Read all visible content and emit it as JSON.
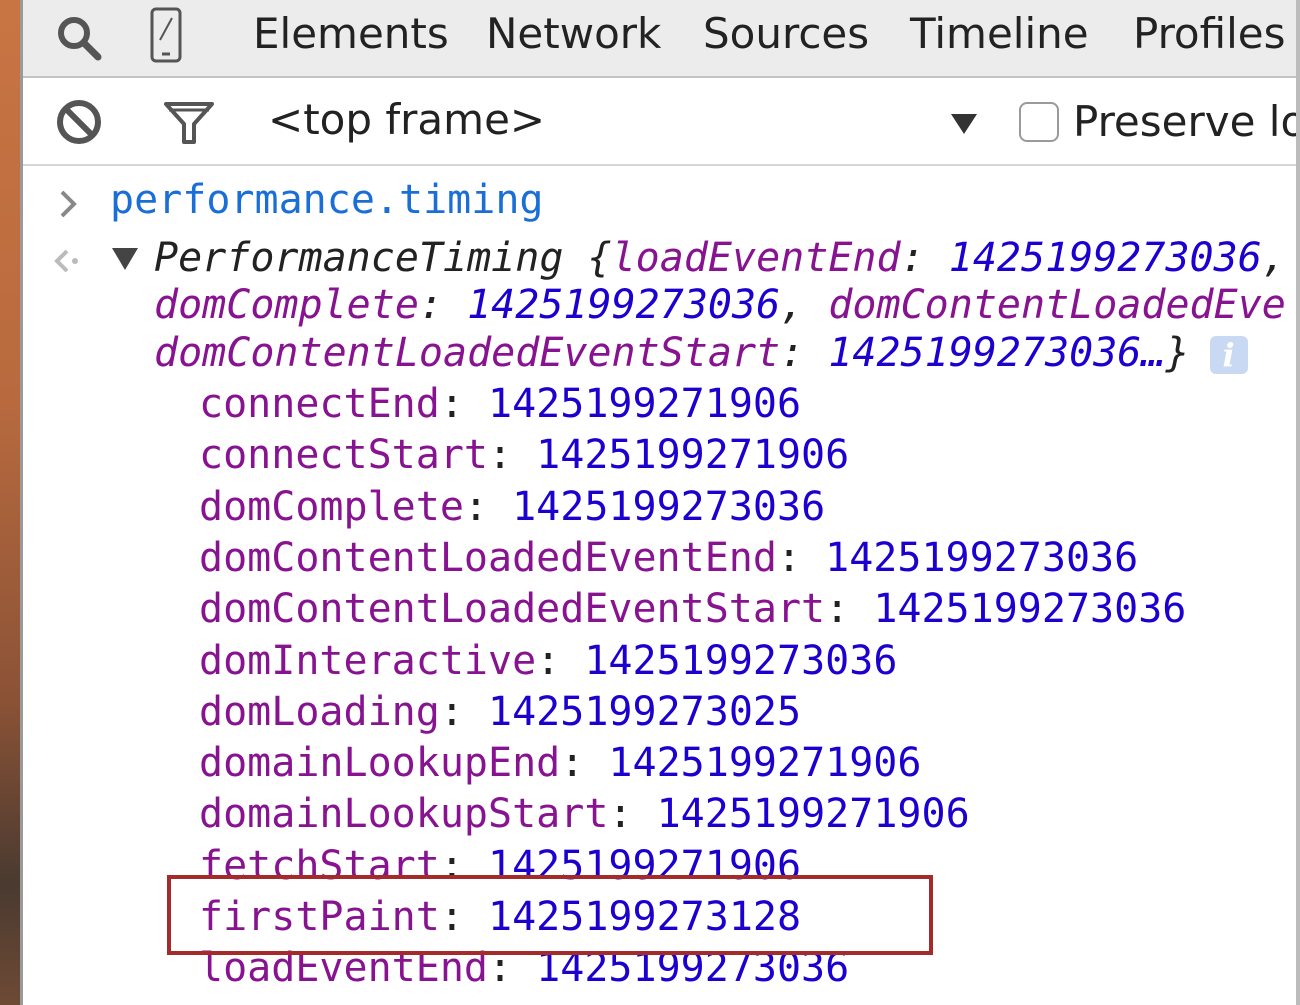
{
  "tabs": [
    "Elements",
    "Network",
    "Sources",
    "Timeline",
    "Profiles"
  ],
  "toolbar": {
    "frame_label": "<top frame>",
    "preserve_label": "Preserve lo"
  },
  "console": {
    "command": "performance.timing",
    "summary": {
      "type_name": "PerformanceTiming",
      "line1_open": " {",
      "line1_key": "loadEventEnd",
      "line1_value": "1425199273036",
      "line2_key1": "domComplete",
      "line2_value1": "1425199273036",
      "line2_key2": "domContentLoadedEve",
      "line3_key": "domContentLoadedEventStart",
      "line3_value": "1425199273036…",
      "line3_close": "}",
      "info_glyph": "i"
    },
    "properties": [
      {
        "key": "connectEnd",
        "value": "1425199271906"
      },
      {
        "key": "connectStart",
        "value": "1425199271906"
      },
      {
        "key": "domComplete",
        "value": "1425199273036"
      },
      {
        "key": "domContentLoadedEventEnd",
        "value": "1425199273036"
      },
      {
        "key": "domContentLoadedEventStart",
        "value": "1425199273036"
      },
      {
        "key": "domInteractive",
        "value": "1425199273036"
      },
      {
        "key": "domLoading",
        "value": "1425199273025"
      },
      {
        "key": "domainLookupEnd",
        "value": "1425199271906"
      },
      {
        "key": "domainLookupStart",
        "value": "1425199271906"
      },
      {
        "key": "fetchStart",
        "value": "1425199271906"
      },
      {
        "key": "firstPaint",
        "value": "1425199273128"
      },
      {
        "key": "loadEventEnd",
        "value": "1425199273036"
      }
    ]
  },
  "colors": {
    "key": "#881391",
    "number": "#1c00cf",
    "command": "#1a6fd6",
    "highlight": "#a52a2a"
  },
  "icons": [
    "search-icon",
    "device-mode-icon",
    "clear-console-icon",
    "filter-icon",
    "dropdown-arrow-icon",
    "prompt-chevron-icon",
    "result-arrow-icon",
    "disclosure-triangle-icon",
    "info-icon"
  ]
}
